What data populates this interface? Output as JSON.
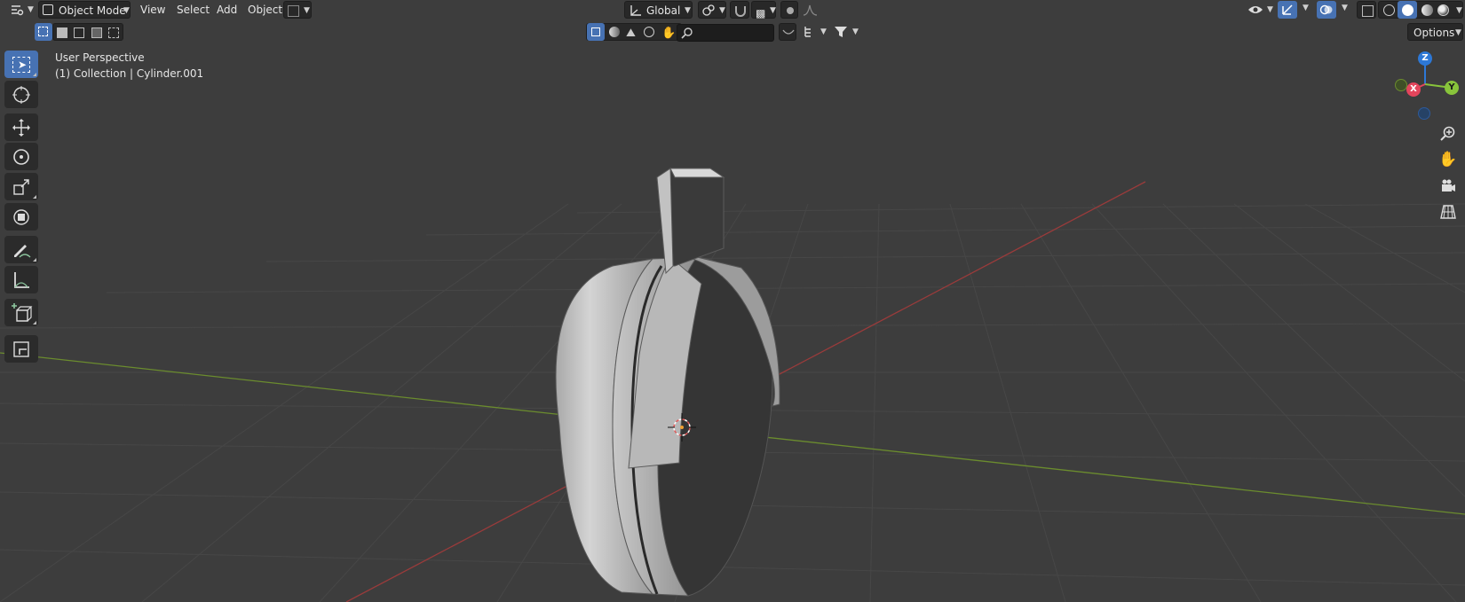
{
  "header": {
    "mode_label": "Object Mode",
    "menus": [
      "View",
      "Select",
      "Add",
      "Object"
    ],
    "transform_orientation": "Global",
    "options_label": "Options"
  },
  "filter": {
    "search_placeholder": ""
  },
  "viewport_overlay": {
    "view_name": "User Perspective",
    "collection_info": "(1) Collection | Cylinder.001"
  },
  "gizmo": {
    "z_label": "Z",
    "x_label": "X",
    "y_label": "Y"
  },
  "colors": {
    "background": "#3d3d3d",
    "accent": "#4772b3",
    "x_axis": "#e3455c",
    "y_axis": "#88c43b",
    "z_axis": "#2d78d6"
  }
}
